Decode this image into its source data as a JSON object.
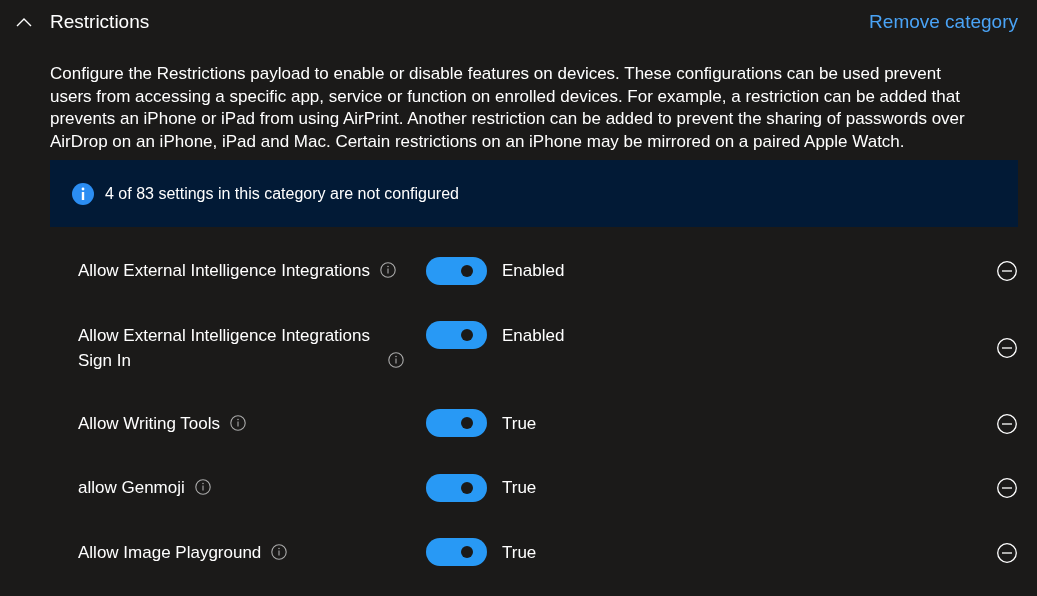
{
  "category": {
    "title": "Restrictions",
    "expanded": true,
    "action": "Remove category"
  },
  "description": "Configure the Restrictions payload to enable or disable features on devices. These configurations can be used prevent users from accessing a specific app, service or function on enrolled devices. For example, a restriction can be added that prevents an iPhone or iPad from using AirPrint. Another restriction can be added to prevent the sharing of passwords over AirDrop on an iPhone, iPad and Mac. Certain restrictions on an iPhone may be mirrored on a paired Apple Watch.",
  "banner": {
    "text": "4 of 83 settings in this category are not configured"
  },
  "settings": [
    {
      "label": "Allow External Intelligence Integrations",
      "on": true,
      "value": "Enabled"
    },
    {
      "label": "Allow External Intelligence Integrations Sign In",
      "on": true,
      "value": "Enabled"
    },
    {
      "label": "Allow Writing Tools",
      "on": true,
      "value": "True"
    },
    {
      "label": "allow Genmoji",
      "on": true,
      "value": "True"
    },
    {
      "label": "Allow Image Playground",
      "on": true,
      "value": "True"
    }
  ]
}
